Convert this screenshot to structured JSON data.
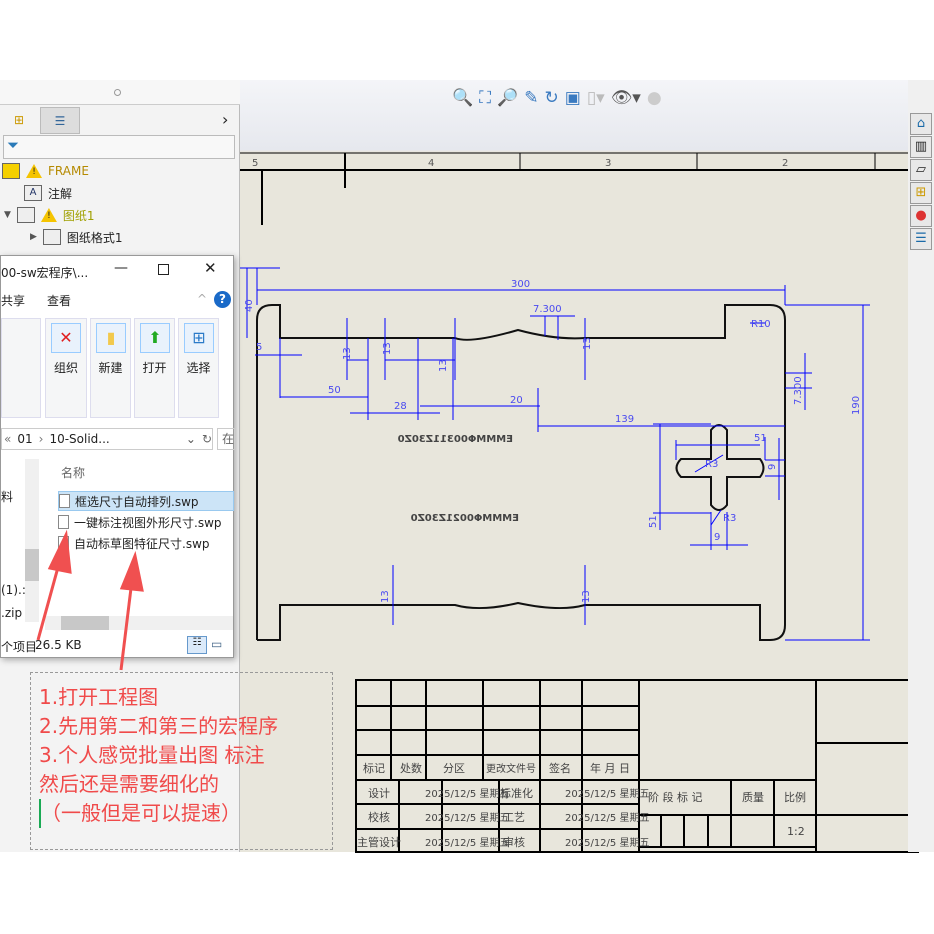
{
  "feature_tree": {
    "items": [
      {
        "label": "FRAME",
        "icon": "drawing-icon",
        "warning": true
      },
      {
        "label": "注解",
        "icon": "annotation-folder-icon"
      },
      {
        "label": "图纸1",
        "icon": "sheet-icon",
        "warning": true
      },
      {
        "label": "图纸格式1",
        "icon": "sheet-format-icon"
      }
    ]
  },
  "toolbar": {
    "icons": [
      "zoom-to-fit-icon",
      "zoom-area-icon",
      "zoom-in-out-icon",
      "pan-icon",
      "rotate-icon",
      "view-orientation-icon",
      "display-style-icon",
      "hide-show-icon",
      "appearance-icon"
    ]
  },
  "sheet": {
    "zones": [
      "5",
      "4",
      "3",
      "2"
    ]
  },
  "drawing": {
    "engraving_top": "EMMMΦ00311Z30Z0",
    "engraving_bottom": "EMMMΦ0021Z30Z0",
    "dims": [
      "300",
      "7.300",
      "R10",
      "5",
      "13",
      "13",
      "13",
      "13",
      "50",
      "28",
      "20",
      "139",
      "7.300",
      "190",
      "R3",
      "51",
      "9",
      "51",
      "R3",
      "9",
      "13",
      "13",
      "40"
    ]
  },
  "title_block": {
    "header": [
      "标记",
      "处数",
      "分区",
      "更改文件号",
      "签名",
      "年 月 日"
    ],
    "rows": [
      {
        "role": "设计",
        "date": "2025/12/5 星期五",
        "role2": "标准化",
        "date2": "2025/12/5 星期五"
      },
      {
        "role": "校核",
        "date": "2025/12/5 星期五",
        "role2": "工艺",
        "date2": "2025/12/5 星期五"
      },
      {
        "role": "主管设计",
        "date": "2025/12/5 星期五",
        "role2": "审核",
        "date2": "2025/12/5 星期五"
      }
    ],
    "stage_mark": "阶 段 标 记",
    "mass": "质量",
    "scale_label": "比例",
    "scale": "1:2"
  },
  "explorer": {
    "title": "00-sw宏程序\\...",
    "tabs": [
      "共享",
      "查看"
    ],
    "ribbon": [
      "组织",
      "新建",
      "打开",
      "选择"
    ],
    "address": [
      "01",
      "10-Solid..."
    ],
    "search_placeholder": "在",
    "column": "名称",
    "files": [
      "框选尺寸自动排列.swp",
      "一键标注视图外形尺寸.swp",
      "自动标草图特征尺寸.swp"
    ],
    "left_items": [
      "料",
      "(1).:",
      ".zip"
    ],
    "status_items": "个项目",
    "status_size": "26.5 KB"
  },
  "note": {
    "lines": [
      "1.打开工程图",
      "2.先用第二和第三的宏程序",
      "3.个人感觉批量出图 标注",
      "然后还是需要细化的",
      "（一般但是可以提速）"
    ],
    "color": "#f04a4a"
  },
  "colors": {
    "dimension": "#0000ff",
    "sheet": "#e8e6dc",
    "annotation": "#f04a4a"
  }
}
